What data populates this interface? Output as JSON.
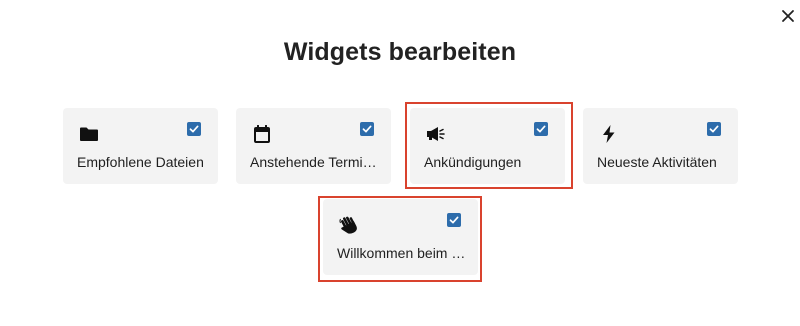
{
  "dialog": {
    "title": "Widgets bearbeiten"
  },
  "widgets": [
    {
      "label": "Empfohlene Dateien",
      "icon": "folder-icon",
      "checked": true
    },
    {
      "label": "Anstehende Termi…",
      "icon": "calendar-icon",
      "checked": true
    },
    {
      "label": "Ankündigungen",
      "icon": "megaphone-icon",
      "checked": true
    },
    {
      "label": "Neueste Aktivitäten",
      "icon": "lightning-icon",
      "checked": true
    },
    {
      "label": "Willkommen beim …",
      "icon": "waving-hand-icon",
      "checked": true
    }
  ],
  "colors": {
    "checkbox": "#2d6cab",
    "highlight": "#d9432e",
    "card_background": "#f3f3f3"
  }
}
